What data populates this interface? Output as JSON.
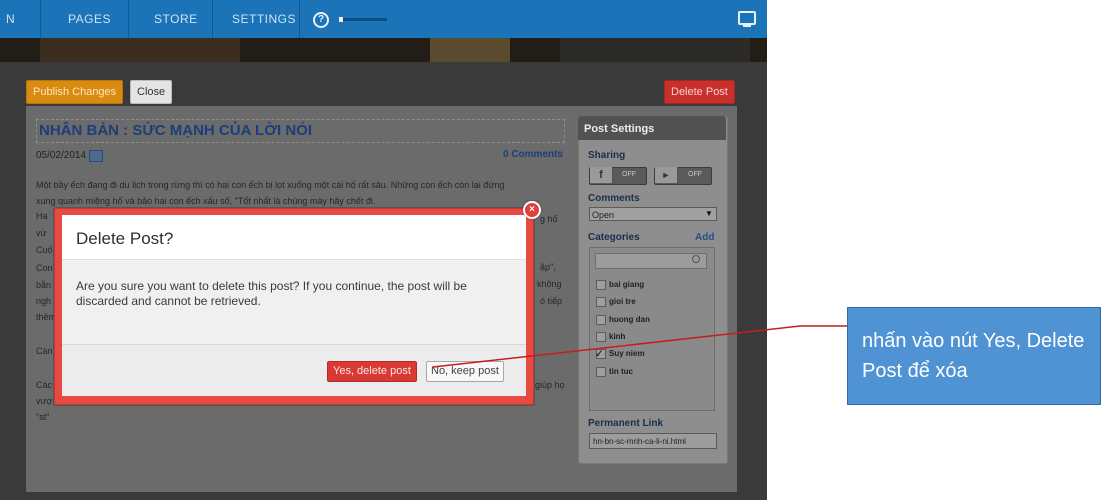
{
  "nav": {
    "partial_item": "N",
    "pages": "PAGES",
    "store": "STORE",
    "settings": "SETTINGS",
    "help_icon": "?",
    "right_icon": "monitor-icon"
  },
  "editor": {
    "publish_label": "Publish Changes",
    "close_label": "Close",
    "delete_post_label": "Delete Post",
    "post_title": "NHÂN BẢN : SỨC MẠNH CỦA LỜI NÓI",
    "post_date": "05/02/2014",
    "comments_link": "0 Comments",
    "body_lines": [
      "Một bầy ếch đang đi du lịch trong rừng thì có hai con ếch bị lọt xuống một cái hố rất sâu. Những con ếch còn lại đứng",
      "xung quanh miệng hố và bảo hai con ếch xấu số, \"Tốt nhất là chúng mày hãy chết đi."
    ],
    "body_fragments": [
      "Ha",
      "vừ",
      "Cuố",
      "Con",
      "bằn",
      "ngh",
      "thêm",
      "Càn",
      "Các",
      "vượ",
      "\"st\"",
      "g hố",
      "ập\",",
      "không",
      "ó tiếp",
      "giúp họ"
    ]
  },
  "sidebar": {
    "title": "Post Settings",
    "sharing_label": "Sharing",
    "facebook_icon": "f",
    "facebook_state": "OFF",
    "twitter_icon": "twitter-bird",
    "twitter_state": "OFF",
    "comments_label": "Comments",
    "comments_value": "Open",
    "categories_label": "Categories",
    "add_label": "Add",
    "categories": [
      {
        "label": "bai giang",
        "checked": false
      },
      {
        "label": "gioi tre",
        "checked": false
      },
      {
        "label": "huong dan",
        "checked": false
      },
      {
        "label": "kinh",
        "checked": false
      },
      {
        "label": "Suy niem",
        "checked": true
      },
      {
        "label": "tin tuc",
        "checked": false
      }
    ],
    "permanent_link_label": "Permanent Link",
    "permanent_link_value": "hn-bn-sc-mnh-ca-li-ni.html"
  },
  "modal": {
    "title": "Delete Post?",
    "message": "Are you sure you want to delete this post? If you continue, the post will be discarded and cannot be retrieved.",
    "confirm_label": "Yes, delete post",
    "cancel_label": "No, keep post",
    "close_icon": "×"
  },
  "callout": {
    "text": "nhấn vào nút Yes, Delete Post để xóa"
  },
  "colors": {
    "nav_bar": "#1b74b8",
    "modal_border": "#e64a43",
    "confirm_button": "#d83a33",
    "callout": "#4f93d4"
  }
}
